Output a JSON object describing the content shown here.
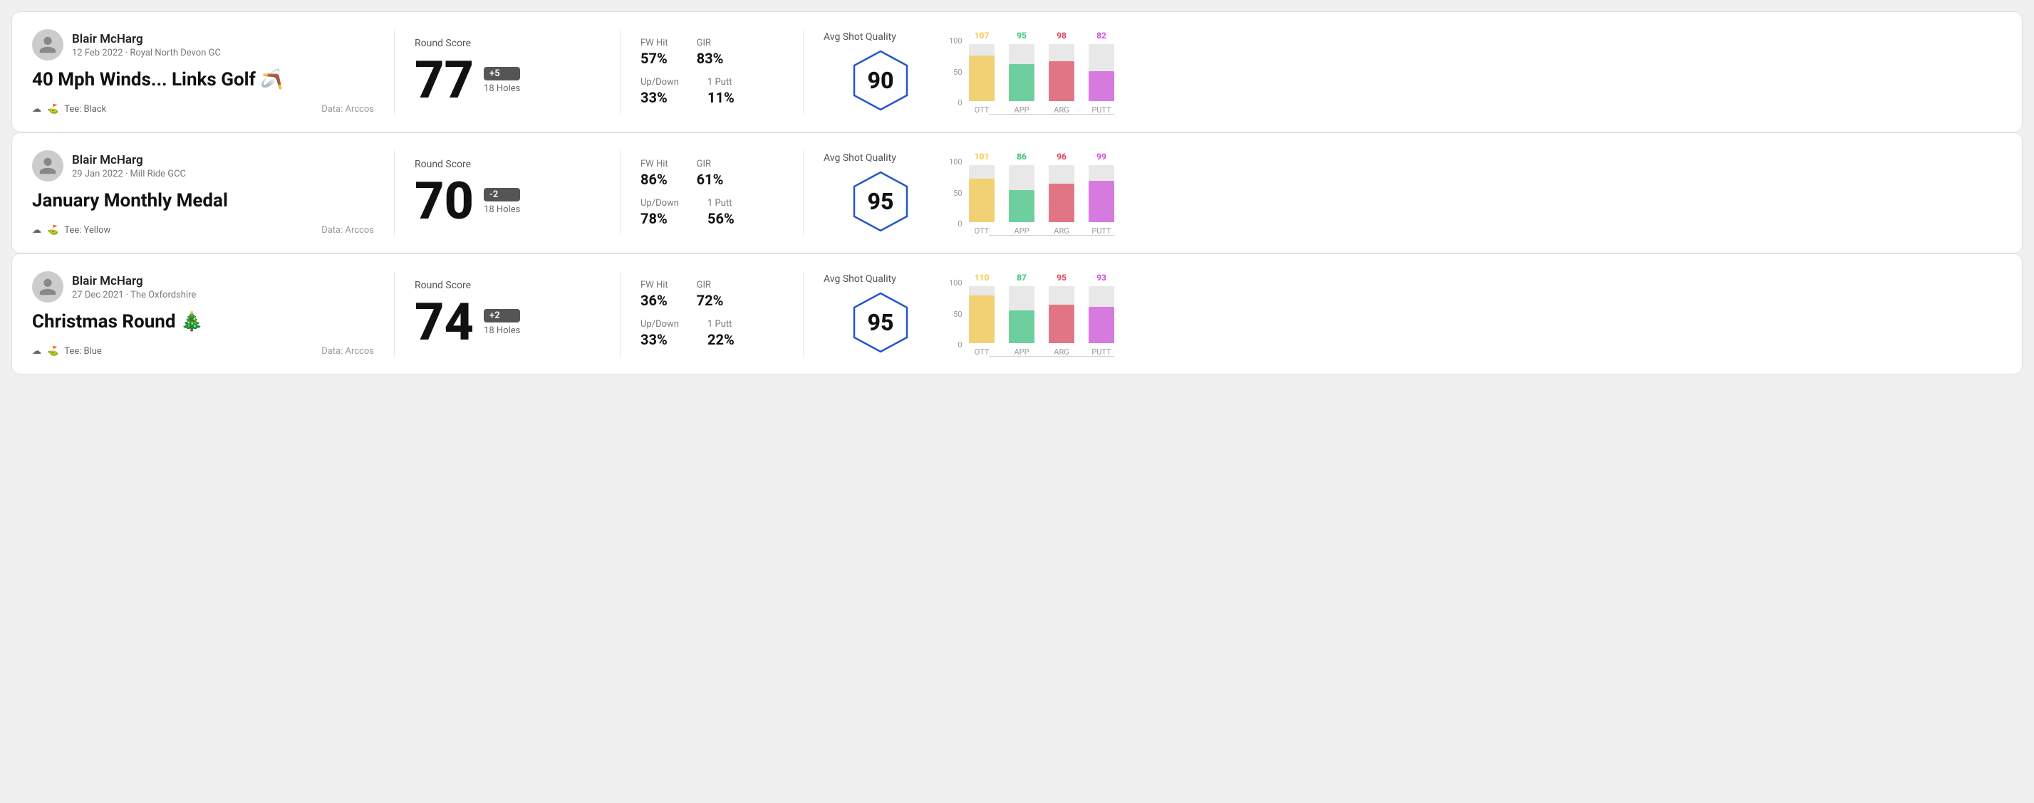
{
  "rounds": [
    {
      "id": "round1",
      "player": {
        "name": "Blair McHarg",
        "date": "12 Feb 2022 · Royal North Devon GC"
      },
      "title": "40 Mph Winds... Links Golf 🪃",
      "tee": "Black",
      "data_source": "Data: Arccos",
      "round_score_label": "Round Score",
      "score": "77",
      "badge": "+5",
      "holes": "18 Holes",
      "stats": {
        "fw_hit_label": "FW Hit",
        "fw_hit_value": "57%",
        "gir_label": "GIR",
        "gir_value": "83%",
        "updown_label": "Up/Down",
        "updown_value": "33%",
        "one_putt_label": "1 Putt",
        "one_putt_value": "11%"
      },
      "quality_label": "Avg Shot Quality",
      "quality_score": "90",
      "chart": {
        "y_labels": [
          "100",
          "50",
          "0"
        ],
        "bars": [
          {
            "label": "OTT",
            "value": 107,
            "top_label": "107",
            "color": "#f5c842",
            "height_pct": 80
          },
          {
            "label": "APP",
            "value": 95,
            "top_label": "95",
            "color": "#3bc47f",
            "height_pct": 65
          },
          {
            "label": "ARG",
            "value": 98,
            "top_label": "98",
            "color": "#e0445a",
            "height_pct": 70
          },
          {
            "label": "PUTT",
            "value": 82,
            "top_label": "82",
            "color": "#d04bdc",
            "height_pct": 52
          }
        ]
      }
    },
    {
      "id": "round2",
      "player": {
        "name": "Blair McHarg",
        "date": "29 Jan 2022 · Mill Ride GCC"
      },
      "title": "January Monthly Medal",
      "tee": "Yellow",
      "data_source": "Data: Arccos",
      "round_score_label": "Round Score",
      "score": "70",
      "badge": "-2",
      "holes": "18 Holes",
      "stats": {
        "fw_hit_label": "FW Hit",
        "fw_hit_value": "86%",
        "gir_label": "GIR",
        "gir_value": "61%",
        "updown_label": "Up/Down",
        "updown_value": "78%",
        "one_putt_label": "1 Putt",
        "one_putt_value": "56%"
      },
      "quality_label": "Avg Shot Quality",
      "quality_score": "95",
      "chart": {
        "y_labels": [
          "100",
          "50",
          "0"
        ],
        "bars": [
          {
            "label": "OTT",
            "value": 101,
            "top_label": "101",
            "color": "#f5c842",
            "height_pct": 76
          },
          {
            "label": "APP",
            "value": 86,
            "top_label": "86",
            "color": "#3bc47f",
            "height_pct": 56
          },
          {
            "label": "ARG",
            "value": 96,
            "top_label": "96",
            "color": "#e0445a",
            "height_pct": 68
          },
          {
            "label": "PUTT",
            "value": 99,
            "top_label": "99",
            "color": "#d04bdc",
            "height_pct": 72
          }
        ]
      }
    },
    {
      "id": "round3",
      "player": {
        "name": "Blair McHarg",
        "date": "27 Dec 2021 · The Oxfordshire"
      },
      "title": "Christmas Round 🎄",
      "tee": "Blue",
      "data_source": "Data: Arccos",
      "round_score_label": "Round Score",
      "score": "74",
      "badge": "+2",
      "holes": "18 Holes",
      "stats": {
        "fw_hit_label": "FW Hit",
        "fw_hit_value": "36%",
        "gir_label": "GIR",
        "gir_value": "72%",
        "updown_label": "Up/Down",
        "updown_value": "33%",
        "one_putt_label": "1 Putt",
        "one_putt_value": "22%"
      },
      "quality_label": "Avg Shot Quality",
      "quality_score": "95",
      "chart": {
        "y_labels": [
          "100",
          "50",
          "0"
        ],
        "bars": [
          {
            "label": "OTT",
            "value": 110,
            "top_label": "110",
            "color": "#f5c842",
            "height_pct": 84
          },
          {
            "label": "APP",
            "value": 87,
            "top_label": "87",
            "color": "#3bc47f",
            "height_pct": 57
          },
          {
            "label": "ARG",
            "value": 95,
            "top_label": "95",
            "color": "#e0445a",
            "height_pct": 67
          },
          {
            "label": "PUTT",
            "value": 93,
            "top_label": "93",
            "color": "#d04bdc",
            "height_pct": 64
          }
        ]
      }
    }
  ],
  "tee_icon": "☁",
  "bag_icon": "⛳"
}
